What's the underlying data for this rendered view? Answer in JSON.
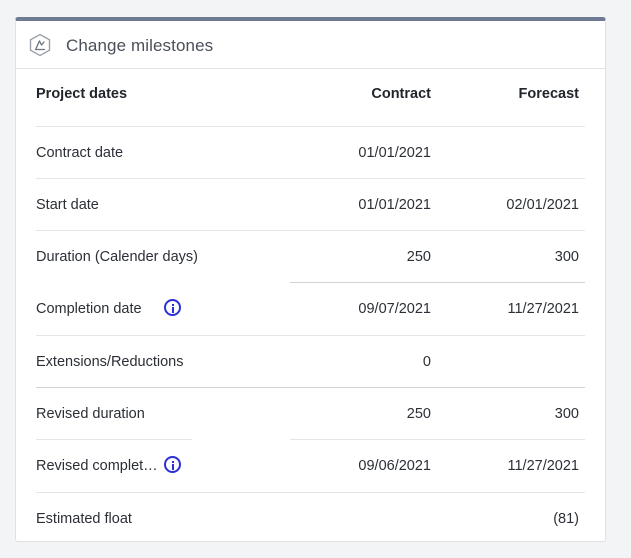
{
  "header": {
    "title": "Change milestones",
    "icon": "milestone-hexagon-icon"
  },
  "table": {
    "columns": {
      "label": "Project dates",
      "contract": "Contract",
      "forecast": "Forecast"
    },
    "rows": [
      {
        "label": "Contract date",
        "contract": "01/01/2021",
        "forecast": "",
        "info": false
      },
      {
        "label": "Start date",
        "contract": "01/01/2021",
        "forecast": "02/01/2021",
        "info": false
      },
      {
        "label": "Duration (Calender days)",
        "contract": "250",
        "forecast": "300",
        "info": false
      },
      {
        "label": "Completion date",
        "contract": "09/07/2021",
        "forecast": "11/27/2021",
        "info": true
      },
      {
        "label": "Extensions/Reductions",
        "contract": "0",
        "forecast": "",
        "info": false
      },
      {
        "label": "Revised duration",
        "contract": "250",
        "forecast": "300",
        "info": false
      },
      {
        "label": "Revised complet…",
        "contract": "09/06/2021",
        "forecast": "11/27/2021",
        "info": true
      },
      {
        "label": "Estimated float",
        "contract": "",
        "forecast": "(81)",
        "info": false
      }
    ]
  },
  "colors": {
    "accent_bar": "#6f7a93",
    "info_icon": "#2c2fd6"
  }
}
